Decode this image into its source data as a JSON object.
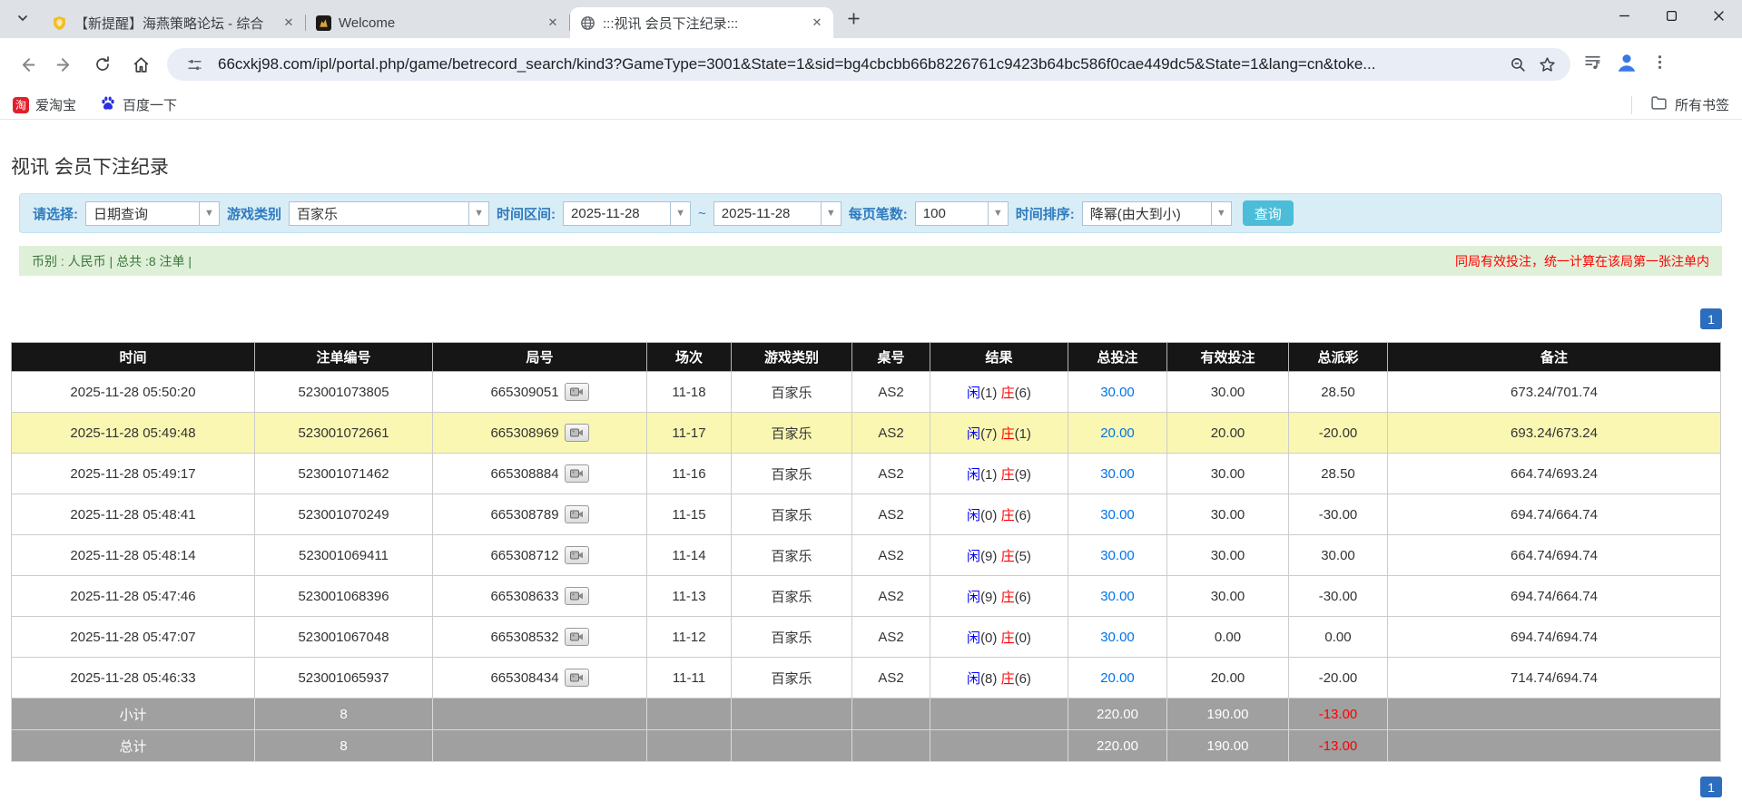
{
  "browser": {
    "tabs": [
      {
        "title": "【新提醒】海燕策略论坛 - 综合"
      },
      {
        "title": "Welcome"
      },
      {
        "title": ":::视讯 会员下注纪录:::"
      }
    ],
    "url": "66cxkj98.com/ipl/portal.php/game/betrecord_search/kind3?GameType=3001&State=1&sid=bg4cbcbb66b8226761c9423b64bc586f0cae449dc5&State=1&lang=cn&toke...",
    "bookmarks": {
      "taobao_label": "爱淘宝",
      "taobao_glyph": "淘",
      "baidu_label": "百度一下",
      "all_label": "所有书签"
    }
  },
  "page": {
    "title": "视讯 会员下注纪录",
    "filter": {
      "select_label": "请选择:",
      "select_value": "日期查询",
      "game_type_label": "游戏类别",
      "game_type_value": "百家乐",
      "date_range_label": "时间区间:",
      "date_from": "2025-11-28",
      "tilde": "~",
      "date_to": "2025-11-28",
      "per_page_label": "每页笔数:",
      "per_page_value": "100",
      "sort_label": "时间排序:",
      "sort_value": "降幂(由大到小)",
      "search_button": "查询"
    },
    "summary": {
      "left": "币别 : 人民币 | 总共 :8 注单 |",
      "right": "同局有效投注，统一计算在该局第一张注单内"
    },
    "pagination": "1",
    "colors": {
      "player_blue": "#0000fe",
      "banker_red": "#fe0000",
      "bet_link_blue": "#0073e6",
      "negative_red": "#fe0000",
      "highlight_yellow": "#faf7b2",
      "header_bg": "#161616",
      "footer_bg": "#a0a0a0"
    },
    "table": {
      "headers": [
        "时间",
        "注单编号",
        "局号",
        "场次",
        "游戏类别",
        "桌号",
        "结果",
        "总投注",
        "有效投注",
        "总派彩",
        "备注"
      ],
      "rows": [
        {
          "time": "2025-11-28 05:50:20",
          "bet_id": "523001073805",
          "round_id": "665309051",
          "session": "11-18",
          "game": "百家乐",
          "table": "AS2",
          "player": "闲(1)",
          "banker": "庄(6)",
          "total_bet": "30.00",
          "valid_bet": "30.00",
          "payout": "28.50",
          "remark": "673.24/701.74",
          "highlight": false
        },
        {
          "time": "2025-11-28 05:49:48",
          "bet_id": "523001072661",
          "round_id": "665308969",
          "session": "11-17",
          "game": "百家乐",
          "table": "AS2",
          "player": "闲(7)",
          "banker": "庄(1)",
          "total_bet": "20.00",
          "valid_bet": "20.00",
          "payout": "-20.00",
          "remark": "693.24/673.24",
          "highlight": true
        },
        {
          "time": "2025-11-28 05:49:17",
          "bet_id": "523001071462",
          "round_id": "665308884",
          "session": "11-16",
          "game": "百家乐",
          "table": "AS2",
          "player": "闲(1)",
          "banker": "庄(9)",
          "total_bet": "30.00",
          "valid_bet": "30.00",
          "payout": "28.50",
          "remark": "664.74/693.24",
          "highlight": false
        },
        {
          "time": "2025-11-28 05:48:41",
          "bet_id": "523001070249",
          "round_id": "665308789",
          "session": "11-15",
          "game": "百家乐",
          "table": "AS2",
          "player": "闲(0)",
          "banker": "庄(6)",
          "total_bet": "30.00",
          "valid_bet": "30.00",
          "payout": "-30.00",
          "remark": "694.74/664.74",
          "highlight": false
        },
        {
          "time": "2025-11-28 05:48:14",
          "bet_id": "523001069411",
          "round_id": "665308712",
          "session": "11-14",
          "game": "百家乐",
          "table": "AS2",
          "player": "闲(9)",
          "banker": "庄(5)",
          "total_bet": "30.00",
          "valid_bet": "30.00",
          "payout": "30.00",
          "remark": "664.74/694.74",
          "highlight": false
        },
        {
          "time": "2025-11-28 05:47:46",
          "bet_id": "523001068396",
          "round_id": "665308633",
          "session": "11-13",
          "game": "百家乐",
          "table": "AS2",
          "player": "闲(9)",
          "banker": "庄(6)",
          "total_bet": "30.00",
          "valid_bet": "30.00",
          "payout": "-30.00",
          "remark": "694.74/664.74",
          "highlight": false
        },
        {
          "time": "2025-11-28 05:47:07",
          "bet_id": "523001067048",
          "round_id": "665308532",
          "session": "11-12",
          "game": "百家乐",
          "table": "AS2",
          "player": "闲(0)",
          "banker": "庄(0)",
          "total_bet": "30.00",
          "valid_bet": "0.00",
          "payout": "0.00",
          "remark": "694.74/694.74",
          "highlight": false
        },
        {
          "time": "2025-11-28 05:46:33",
          "bet_id": "523001065937",
          "round_id": "665308434",
          "session": "11-11",
          "game": "百家乐",
          "table": "AS2",
          "player": "闲(8)",
          "banker": "庄(6)",
          "total_bet": "20.00",
          "valid_bet": "20.00",
          "payout": "-20.00",
          "remark": "714.74/694.74",
          "highlight": false
        }
      ],
      "footer": [
        {
          "label": "小计",
          "count": "8",
          "total_bet": "220.00",
          "valid_bet": "190.00",
          "payout": "-13.00"
        },
        {
          "label": "总计",
          "count": "8",
          "total_bet": "220.00",
          "valid_bet": "190.00",
          "payout": "-13.00"
        }
      ]
    }
  }
}
